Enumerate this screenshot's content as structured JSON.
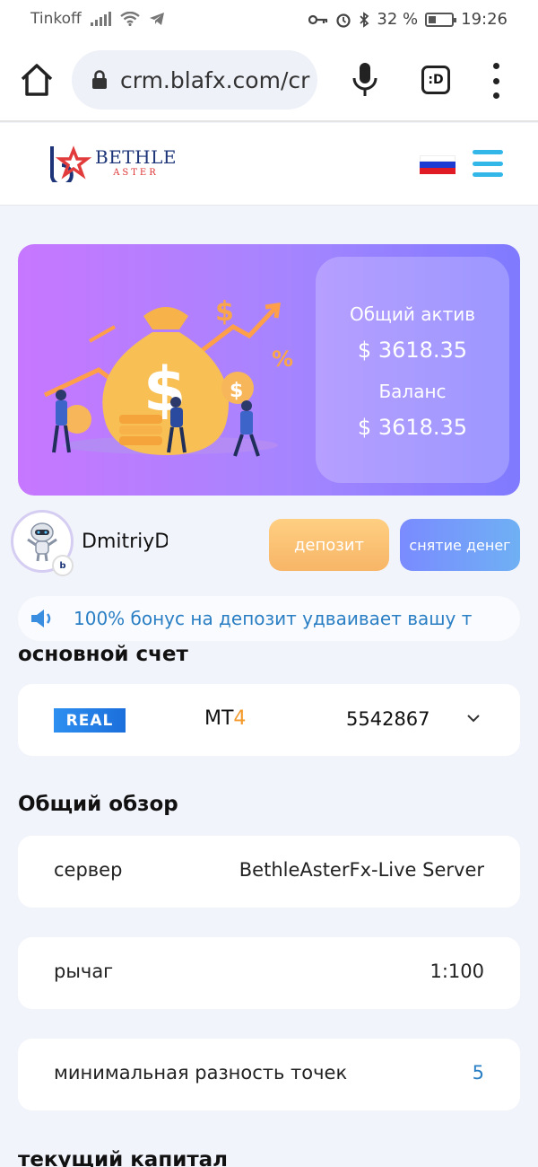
{
  "status_bar": {
    "carrier": "Tinkoff",
    "battery": "32 %",
    "time": "19:26"
  },
  "browser": {
    "url": "crm.blafx.com/cr",
    "tabs_label": ":D"
  },
  "logo": {
    "name": "BETHLE",
    "sub": "ASTER",
    "mark": "b"
  },
  "banner": {
    "total_assets_label": "Общий актив",
    "total_assets_value": "$ 3618.35",
    "balance_label": "Баланс",
    "balance_value": "$ 3618.35"
  },
  "user": {
    "name": "DmitriyD",
    "deposit_label": "депозит",
    "withdraw_label": "снятие денег"
  },
  "notice": {
    "text": "100% бонус на депозит удваивает вашу т"
  },
  "main_account": {
    "heading": "основной счет",
    "type_badge": "REAL",
    "platform_prefix": "MT",
    "platform_num": "4",
    "account_number": "5542867"
  },
  "overview": {
    "heading": "Общий обзор",
    "rows": [
      {
        "label": "сервер",
        "value": "BethleAsterFx-Live Server"
      },
      {
        "label": "рычаг",
        "value": "1:100"
      },
      {
        "label": "минимальная разность точек",
        "value": "5"
      }
    ]
  },
  "current_capital": {
    "heading": "текущий капитал"
  },
  "colors": {
    "accent": "#2a7fc4",
    "banner_start": "#c777ff",
    "banner_end": "#7f7aff",
    "deposit": "#f7b567"
  }
}
